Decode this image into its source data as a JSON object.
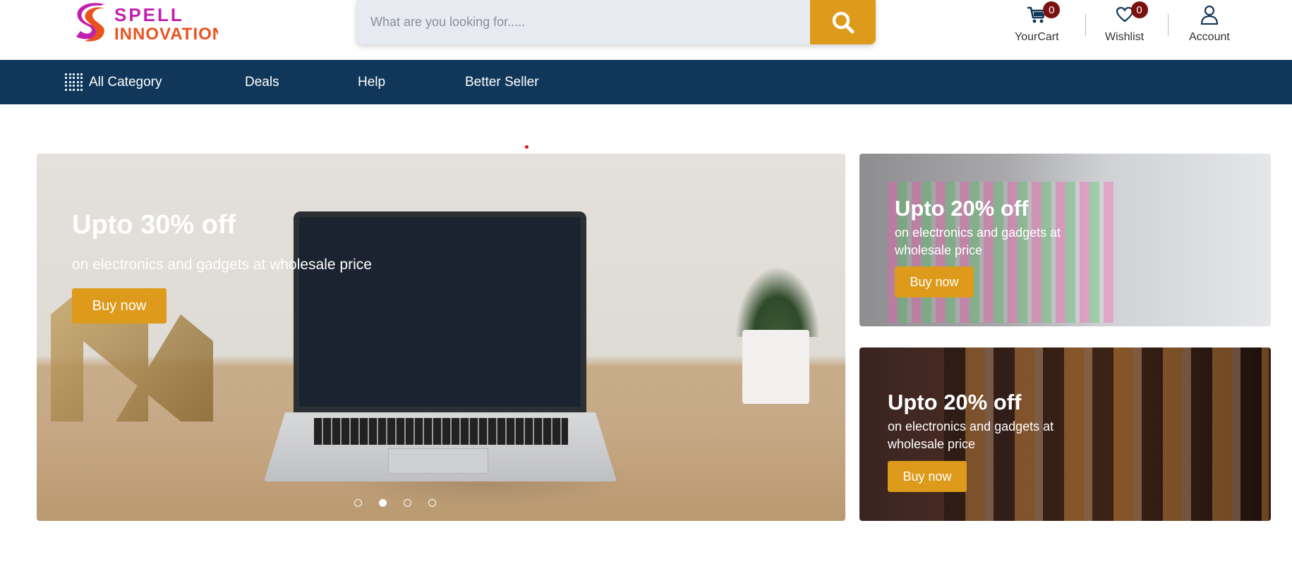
{
  "header": {
    "logo_top": "SPELL",
    "logo_bottom": "INNOVATION",
    "search": {
      "placeholder": "What are you looking for....."
    },
    "actions": {
      "cart": {
        "label": "YourCart",
        "count": "0"
      },
      "wishlist": {
        "label": "Wishlist",
        "count": "0"
      },
      "account": {
        "label": "Account"
      }
    }
  },
  "nav": {
    "items": [
      {
        "label": "All Category"
      },
      {
        "label": "Deals"
      },
      {
        "label": "Help"
      },
      {
        "label": "Better Seller"
      }
    ]
  },
  "banners": {
    "hero": {
      "title": "Upto 30% off",
      "subtitle": "on electronics and gadgets at wholesale price",
      "button": "Buy now"
    },
    "side1": {
      "title": "Upto 20% off",
      "subtitle": "on electronics and gadgets at wholesale price",
      "button": "Buy now"
    },
    "side2": {
      "title": "Upto 20% off",
      "subtitle": "on electronics and gadgets at wholesale price",
      "button": "Buy now"
    }
  },
  "carousel": {
    "slide_count": 4,
    "active_slide": 2
  },
  "colors": {
    "accent": "#de9a1a",
    "nav": "#10375a",
    "badge": "#7a1010",
    "logo_magenta": "#c21fb0",
    "logo_orange": "#e8531f"
  }
}
